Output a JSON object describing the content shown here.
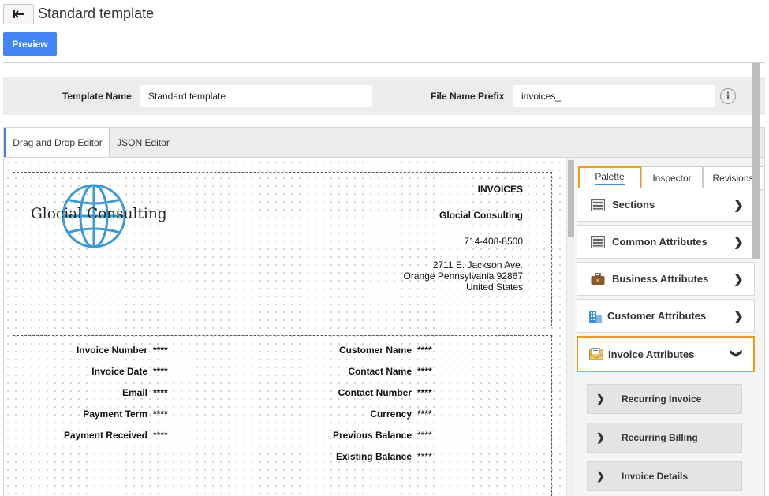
{
  "header": {
    "back_icon": "back-arrow-icon",
    "title": "Standard template",
    "preview_label": "Preview"
  },
  "template_form": {
    "template_name_label": "Template Name",
    "template_name_value": "Standard template",
    "prefix_label": "File Name Prefix",
    "prefix_value": "invoices_",
    "info_icon": "i"
  },
  "editor_tabs": [
    "Drag and Drop Editor",
    "JSON Editor"
  ],
  "invoice_header": {
    "logo_text": "Glocial Consulting",
    "title": "INVOICES",
    "company": "Glocial Consulting",
    "phone": "714-408-8500",
    "address_line1": "2711 E. Jackson Ave.",
    "address_line2": "Orange  Pennsylvania  92867",
    "country": "United States"
  },
  "invoice_fields": {
    "left": [
      {
        "label": "Invoice Number",
        "value": "****"
      },
      {
        "label": "Invoice Date",
        "value": "****"
      },
      {
        "label": "Email",
        "value": "****"
      },
      {
        "label": "Payment Term",
        "value": "****"
      },
      {
        "label": "Payment Received",
        "value": "****"
      }
    ],
    "right": [
      {
        "label": "Customer Name",
        "value": "****"
      },
      {
        "label": "Contact Name",
        "value": "****"
      },
      {
        "label": "Contact Number",
        "value": "****"
      },
      {
        "label": "Currency",
        "value": "****"
      },
      {
        "label": "Previous Balance",
        "value": "****"
      },
      {
        "label": "Existing Balance",
        "value": "****"
      }
    ]
  },
  "side_tabs": [
    "Palette",
    "Inspector",
    "Revisions"
  ],
  "palette": [
    {
      "label": "Sections",
      "icon": "sections-icon"
    },
    {
      "label": "Common Attributes",
      "icon": "common-attributes-icon"
    },
    {
      "label": "Business Attributes",
      "icon": "briefcase-icon"
    },
    {
      "label": "Customer Attributes",
      "icon": "building-icon"
    },
    {
      "label": "Invoice Attributes",
      "icon": "invoice-envelope-icon"
    }
  ],
  "invoice_sub_items": [
    "Recurring Invoice",
    "Recurring Billing",
    "Invoice Details"
  ],
  "colors": {
    "primary": "#4285f4",
    "highlight": "#f39c12",
    "globe": "#3a9ad9"
  }
}
